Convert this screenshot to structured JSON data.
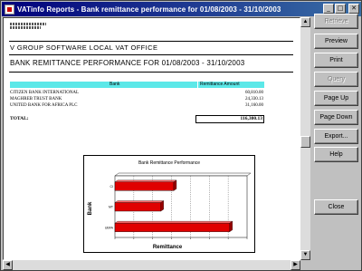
{
  "window": {
    "title": "VATinfo Reports - Bank remittance performance for 01/08/2003 - 31/10/2003",
    "minimize": "_",
    "maximize": "□",
    "close": "✕"
  },
  "sidebar": {
    "buttons": [
      {
        "label": "Retrieve",
        "enabled": false
      },
      {
        "label": "Preview",
        "enabled": true
      },
      {
        "label": "Print",
        "enabled": true
      },
      {
        "label": "Query",
        "enabled": false
      },
      {
        "label": "Page Up",
        "enabled": true
      },
      {
        "label": "Page Down",
        "enabled": true
      },
      {
        "label": "Export...",
        "enabled": true
      },
      {
        "label": "Help",
        "enabled": true
      },
      {
        "label": "Close",
        "enabled": true
      }
    ]
  },
  "report": {
    "office": "V    GROUP SOFTWARE LOCAL VAT OFFICE",
    "title": "BANK REMITTANCE PERFORMANCE FOR 01/08/2003 - 31/10/2003",
    "columns": {
      "bank": "Bank",
      "amount": "Remittance Amount"
    },
    "rows": [
      {
        "bank": "CITIZEN BANK INTERNATIONAL",
        "amount": "60,810.00"
      },
      {
        "bank": "MAGHREB TRUST BANK",
        "amount": "24,330.13"
      },
      {
        "bank": "UNITED BANK FOR AFRICA PLC",
        "amount": "31,160.00"
      }
    ],
    "total_label": "TOTAL:",
    "total_value": "116,300.13"
  },
  "chart_data": {
    "type": "bar",
    "orientation": "horizontal",
    "title": "Bank Remittance Performance",
    "xlabel": "Remittance",
    "ylabel": "Bank",
    "categories": [
      "CI",
      "MT",
      "UBFA"
    ],
    "values": [
      31160,
      24330.13,
      60810
    ],
    "xlim": [
      0,
      70000
    ],
    "bar_color": "#e00000",
    "grid": true
  }
}
